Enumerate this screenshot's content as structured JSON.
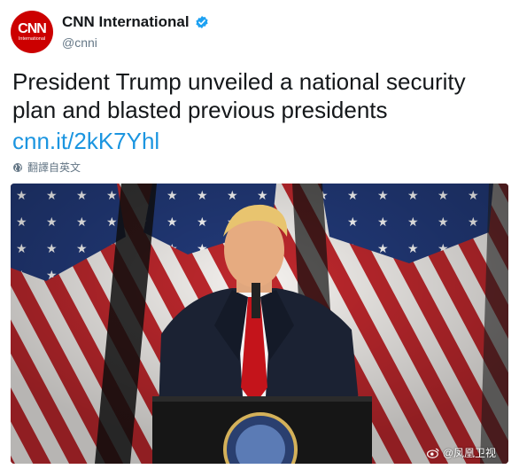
{
  "account": {
    "avatar_text": "CNN",
    "avatar_subtext": "International",
    "display_name": "CNN International",
    "handle": "@cnni"
  },
  "tweet": {
    "text": "President Trump unveiled a national security plan and blasted previous presidents",
    "link": "cnn.it/2kK7Yhl",
    "translate_label": "翻譯自英文"
  },
  "photo": {
    "watermark": "@凤凰卫视"
  },
  "colors": {
    "brand_red": "#cc0000",
    "link_blue": "#1b95e0",
    "verified_blue": "#1da1f2",
    "muted_text": "#657786"
  },
  "icons": [
    "verified-badge-icon",
    "globe-icon",
    "weibo-icon"
  ]
}
